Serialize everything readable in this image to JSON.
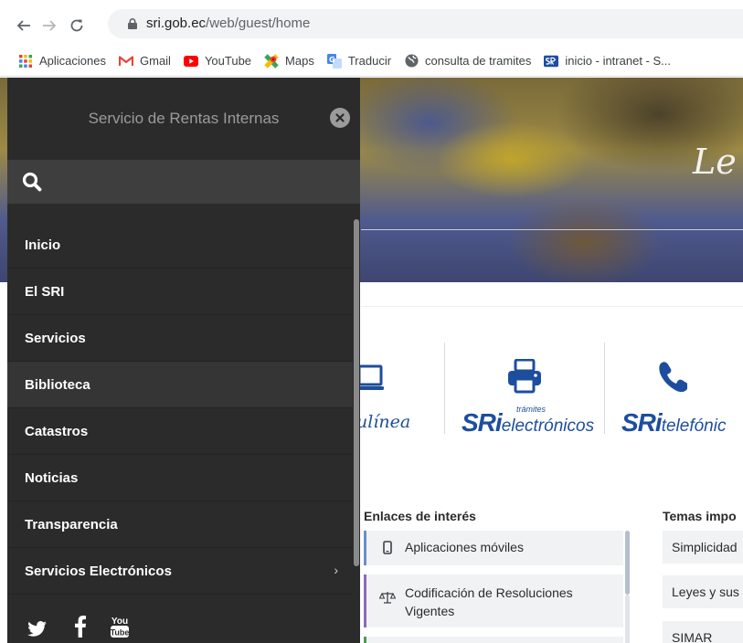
{
  "browser": {
    "url_domain": "sri.gob.ec",
    "url_path": "/web/guest/home",
    "bookmarks": [
      {
        "label": "Aplicaciones",
        "icon": "apps-grid-icon"
      },
      {
        "label": "Gmail",
        "icon": "gmail-icon"
      },
      {
        "label": "YouTube",
        "icon": "youtube-icon"
      },
      {
        "label": "Maps",
        "icon": "maps-icon"
      },
      {
        "label": "Traducir",
        "icon": "translate-icon"
      },
      {
        "label": "consulta de tramites",
        "icon": "globe-icon"
      },
      {
        "label": "inicio - intranet - S...",
        "icon": "sri-icon"
      }
    ]
  },
  "drawer": {
    "title": "Servicio de Rentas Internas",
    "menu": [
      {
        "label": "Inicio"
      },
      {
        "label": "El SRI"
      },
      {
        "label": "Servicios"
      },
      {
        "label": "Biblioteca"
      },
      {
        "label": "Catastros"
      },
      {
        "label": "Noticias"
      },
      {
        "label": "Transparencia"
      },
      {
        "label": "Servicios Electrónicos",
        "chevron": "›"
      }
    ],
    "social": [
      "twitter-icon",
      "facebook-icon",
      "youtube-icon"
    ],
    "social_youtube_text": [
      "You",
      "Tube"
    ]
  },
  "page": {
    "services": {
      "online_text": "ulínea",
      "elec_brand": "SRi",
      "elec_small": "trámites",
      "elec_sub": "electrónicos",
      "tel_brand": "SRi",
      "tel_sub": "telefónic"
    },
    "hero_script": "Le",
    "enlaces_title": "Enlaces de interés",
    "enlaces": [
      {
        "label": "Aplicaciones móviles",
        "icon": "mobile-icon"
      },
      {
        "label": "Codificación de Resoluciones Vigentes",
        "icon": "scales-icon"
      }
    ],
    "temas_title": "Temas impo",
    "temas": [
      "Simplicidad",
      "Leyes y sus",
      "SIMAR"
    ]
  },
  "colors": {
    "drawer_bg": "#2b2b2b",
    "brand_blue": "#1d4e9e"
  }
}
